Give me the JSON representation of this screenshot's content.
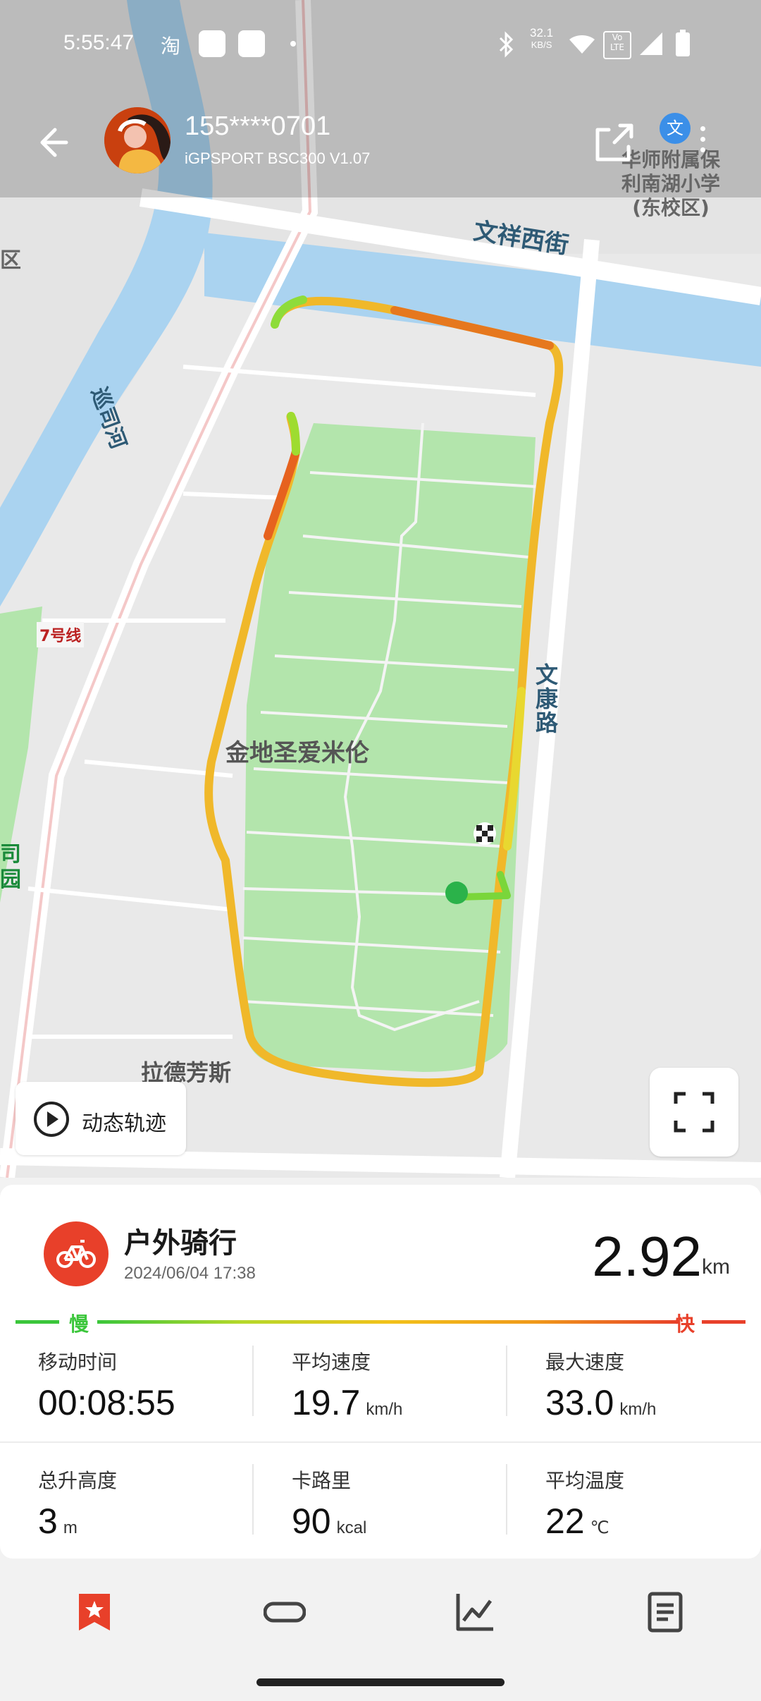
{
  "status_bar": {
    "time": "5:55:47",
    "app_icon": "淘",
    "net_speed": "32.1",
    "net_unit": "KB/S",
    "icons": [
      "bluetooth-icon",
      "wifi-icon",
      "volte-icon",
      "signal-icon",
      "battery-icon"
    ]
  },
  "header": {
    "username": "155****0701",
    "device": "iGPSPORT BSC300  V1.07"
  },
  "map": {
    "labels": {
      "street_wenxiang": "文祥西街",
      "school": "华师附属保\n利南湖小学\n(东校区)",
      "river": "巡司河",
      "metro": "7号线",
      "road_wenkang": "文康路",
      "community": "金地圣爱米伦",
      "laidefangsi": "拉德芳斯",
      "park_partial": "司\n园",
      "edge_left": "区"
    },
    "dynamic_track_label": "动态轨迹"
  },
  "activity": {
    "type": "户外骑行",
    "datetime": "2024/06/04 17:38",
    "distance": "2.92",
    "distance_unit": "km",
    "speed_slow": "慢",
    "speed_fast": "快"
  },
  "stats": [
    {
      "label": "移动时间",
      "value": "00:08:55",
      "unit": ""
    },
    {
      "label": "平均速度",
      "value": "19.7",
      "unit": "km/h"
    },
    {
      "label": "最大速度",
      "value": "33.0",
      "unit": "km/h"
    },
    {
      "label": "总升高度",
      "value": "3",
      "unit": "m"
    },
    {
      "label": "卡路里",
      "value": "90",
      "unit": "kcal"
    },
    {
      "label": "平均温度",
      "value": "22",
      "unit": "℃"
    }
  ],
  "colors": {
    "accent": "#e8402a",
    "slow": "#3bc63b",
    "park": "#b3e5ac",
    "water": "#aad3f0"
  },
  "bottom_nav": [
    "bookmark-icon",
    "track-icon",
    "chart-icon",
    "report-icon"
  ]
}
